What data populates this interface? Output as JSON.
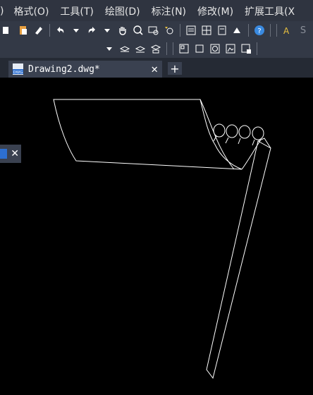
{
  "menubar": {
    "items": [
      ")",
      "格式(O)",
      "工具(T)",
      "绘图(D)",
      "标注(N)",
      "修改(M)",
      "扩展工具(X"
    ]
  },
  "toolbar1": {
    "partial_text": "S",
    "icons": [
      "copy-icon",
      "paste-icon",
      "matchprop-icon",
      "undo-icon",
      "redo-icon",
      "pan-icon",
      "zoom-realtime-icon",
      "zoom-window-icon",
      "zoom-previous-icon",
      "properties-icon",
      "design-center-icon",
      "tool-palettes-icon",
      "markup-icon",
      "help-icon",
      "text-style-icon"
    ]
  },
  "toolbar2": {
    "icons": [
      "dropdown-arrow",
      "layer-state-icon",
      "layer-previous-icon",
      "layer-isolate-icon",
      "viewport-icon",
      "block-icon",
      "circle-icon",
      "image-icon",
      "insert-icon"
    ]
  },
  "tabs": {
    "active_label": "Drawing2.dwg*",
    "file_icon_text": "DWG",
    "close_glyph": "✕",
    "new_tab_glyph": "+"
  },
  "float_panel": {
    "close_glyph": "✕"
  }
}
